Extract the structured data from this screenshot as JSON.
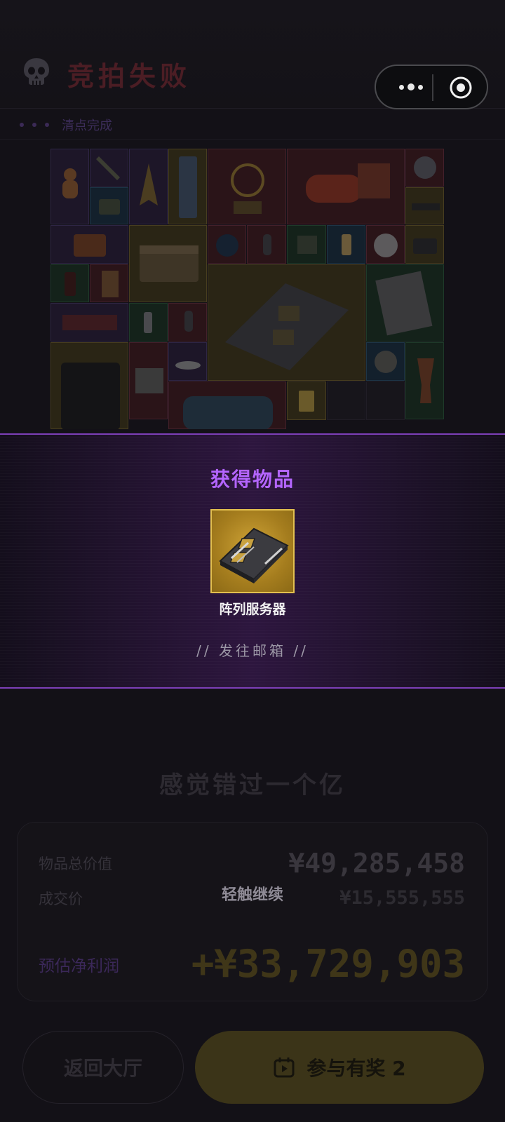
{
  "header": {
    "title": "竞拍失败",
    "skull_icon": "skull-icon",
    "menu_icon": "more-dots-icon",
    "close_icon": "target-circle-icon"
  },
  "status": {
    "text": "清点完成"
  },
  "inventory_grid": {
    "items_shown": 34
  },
  "overlay": {
    "title": "获得物品",
    "item_name": "阵列服务器",
    "item_icon": "server-board-icon",
    "mailbox_text": "// 发往邮箱 //",
    "accent_color": "#b465ff",
    "item_rarity_color": "#cfa437"
  },
  "result": {
    "verdict": "感觉错过一个亿",
    "total_value_label": "物品总价值",
    "total_value": "¥49,285,458",
    "deal_price_label": "成交价",
    "deal_price": "¥15,555,555",
    "net_profit_label": "预估净利润",
    "net_profit": "+¥33,729,903",
    "tap_hint": "轻触继续"
  },
  "buttons": {
    "back_label": "返回大厅",
    "join_label": "参与有奖 2",
    "join_icon": "calendar-play-icon"
  }
}
